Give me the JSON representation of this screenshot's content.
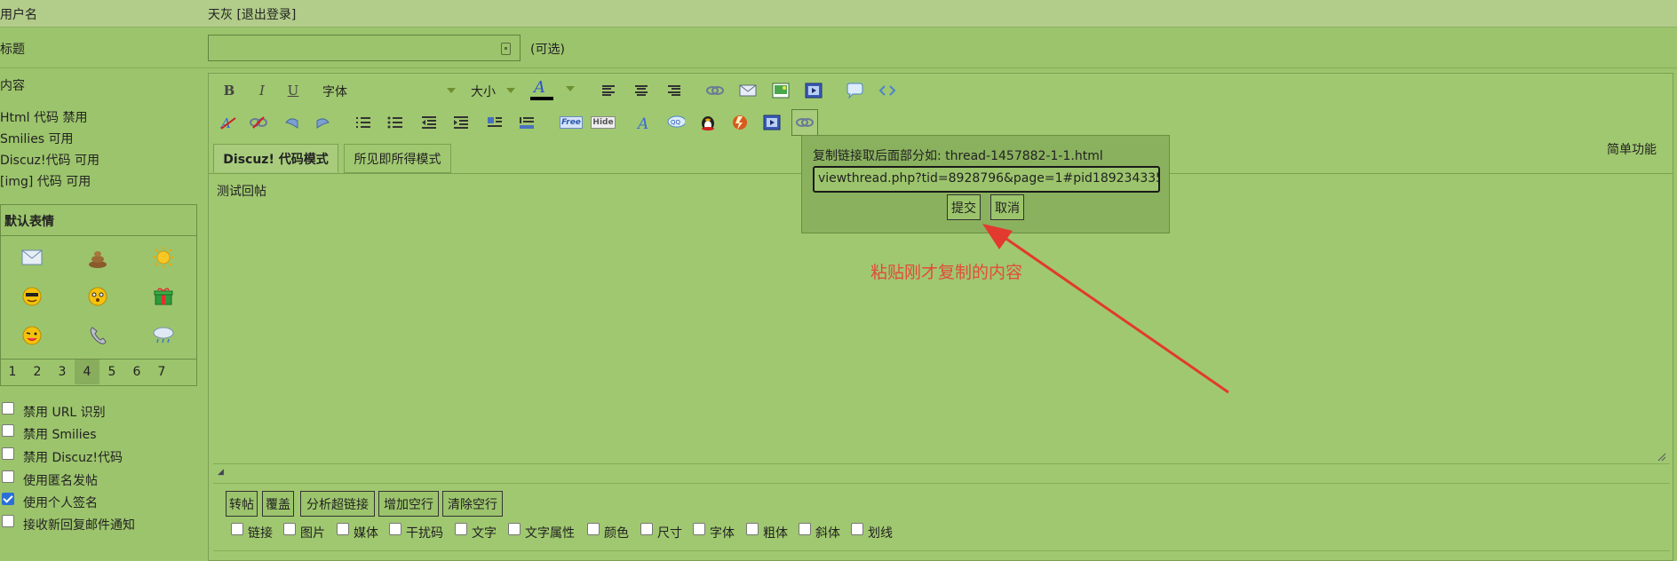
{
  "header": {
    "username_label": "用户名",
    "username_value": "天灰 [退出登录]"
  },
  "title_row": {
    "label": "标题",
    "input_value": "",
    "optional_hint": "(可选)"
  },
  "content_row": {
    "label": "内容",
    "rules": [
      "Html 代码 禁用",
      "Smilies 可用",
      "Discuz!代码 可用",
      "[img] 代码 可用"
    ]
  },
  "toolbar": {
    "bold": "B",
    "italic": "I",
    "underline": "U",
    "font_label": "字体",
    "size_label": "大小",
    "fontcolor": "A",
    "free_label": "Free",
    "hide_label": "Hide",
    "simple_mode": "简单功能"
  },
  "mode_tabs": [
    {
      "label": "Discuz! 代码模式",
      "active": true
    },
    {
      "label": "所见即所得模式",
      "active": false
    }
  ],
  "editor": {
    "content": "测试回帖"
  },
  "link_popup": {
    "instruction": "复制链接取后面部分如: thread-1457882-1-1.html",
    "input_value": "viewthread.php?tid=8928796&page=1#pid189234335",
    "submit_label": "提交",
    "cancel_label": "取消"
  },
  "annotation": {
    "text": "粘贴刚才复制的内容",
    "color": "#e24b3b"
  },
  "smilies": {
    "title": "默认表情",
    "pages": [
      "1",
      "2",
      "3",
      "4",
      "5",
      "6",
      "7"
    ],
    "active_page": "4"
  },
  "options": [
    {
      "label": "禁用 URL 识别",
      "checked": false
    },
    {
      "label": "禁用 Smilies",
      "checked": false
    },
    {
      "label": "禁用 Discuz!代码",
      "checked": false
    },
    {
      "label": "使用匿名发帖",
      "checked": false
    },
    {
      "label": "使用个人签名",
      "checked": true
    },
    {
      "label": "接收新回复邮件通知",
      "checked": false
    }
  ],
  "bottom_buttons": [
    "转帖",
    "覆盖",
    "分析超链接",
    "增加空行",
    "清除空行"
  ],
  "filters": [
    "链接",
    "图片",
    "媒体",
    "干扰码",
    "文字",
    "文字属性",
    "颜色",
    "尺寸",
    "字体",
    "粗体",
    "斜体",
    "划线"
  ],
  "colors": {
    "background": "#9cc46c",
    "topbar": "#b2cc8a",
    "accent_red": "#e24b3b"
  }
}
